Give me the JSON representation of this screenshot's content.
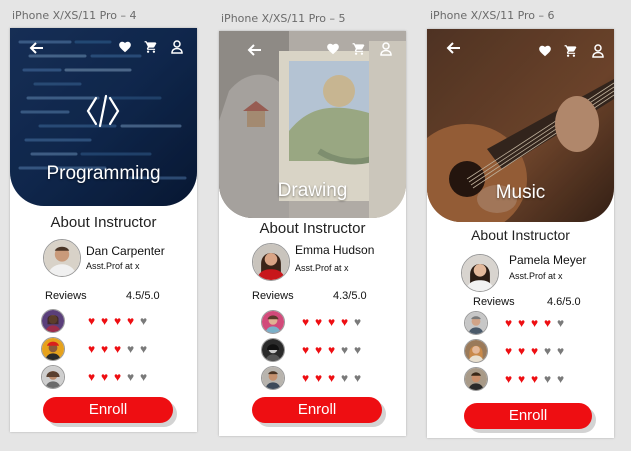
{
  "colors": {
    "accent": "#ee0e12",
    "heart_on": "#ee0e12",
    "heart_off": "#7a7a7a",
    "hero_text": "#ffffff"
  },
  "icons": [
    "back-arrow-icon",
    "heart-icon",
    "cart-icon",
    "user-icon",
    "code-icon"
  ],
  "screens": [
    {
      "frame_label": "iPhone X/XS/11 Pro – 4",
      "category": "Programming",
      "about": "About Instructor",
      "instructor": {
        "name": "Dan Carpenter",
        "title": "Asst.Prof at x"
      },
      "reviews": {
        "label": "Reviews",
        "score": "4.5/5.0",
        "items": [
          {
            "rating": 4
          },
          {
            "rating": 3
          },
          {
            "rating": 3
          }
        ]
      },
      "enroll": "Enroll"
    },
    {
      "frame_label": "iPhone X/XS/11 Pro – 5",
      "category": "Drawing",
      "about": "About Instructor",
      "instructor": {
        "name": "Emma Hudson",
        "title": "Asst.Prof at x"
      },
      "reviews": {
        "label": "Reviews",
        "score": "4.3/5.0",
        "items": [
          {
            "rating": 4
          },
          {
            "rating": 3
          },
          {
            "rating": 3
          }
        ]
      },
      "enroll": "Enroll"
    },
    {
      "frame_label": "iPhone X/XS/11 Pro – 6",
      "category": "Music",
      "about": "About Instructor",
      "instructor": {
        "name": "Pamela Meyer",
        "title": "Asst.Prof at x"
      },
      "reviews": {
        "label": "Reviews",
        "score": "4.6/5.0",
        "items": [
          {
            "rating": 4
          },
          {
            "rating": 3
          },
          {
            "rating": 3
          }
        ]
      },
      "enroll": "Enroll"
    }
  ]
}
